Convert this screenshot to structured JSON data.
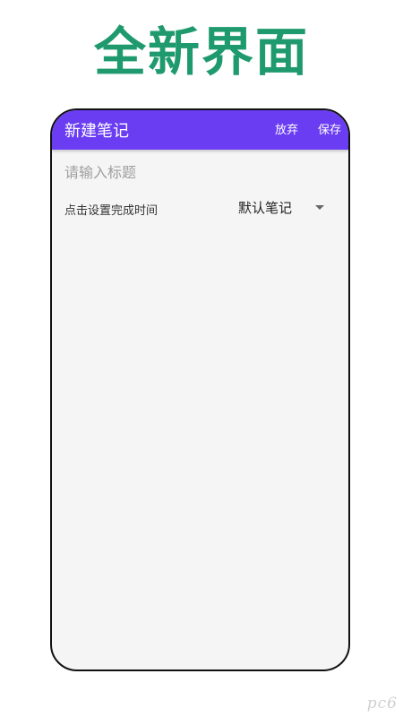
{
  "promo": {
    "title": "全新界面"
  },
  "app_bar": {
    "title": "新建笔记",
    "discard_label": "放弃",
    "save_label": "保存",
    "color": "#6a3cf2"
  },
  "form": {
    "title_placeholder": "请输入标题",
    "title_value": "",
    "due_time_label": "点击设置完成时间",
    "category": {
      "selected": "默认笔记"
    }
  },
  "watermark": {
    "text": "pc6"
  },
  "colors": {
    "promo_green": "#1f9a6e",
    "app_bar": "#6a3cf2",
    "page_background": "#f5f5f5"
  }
}
